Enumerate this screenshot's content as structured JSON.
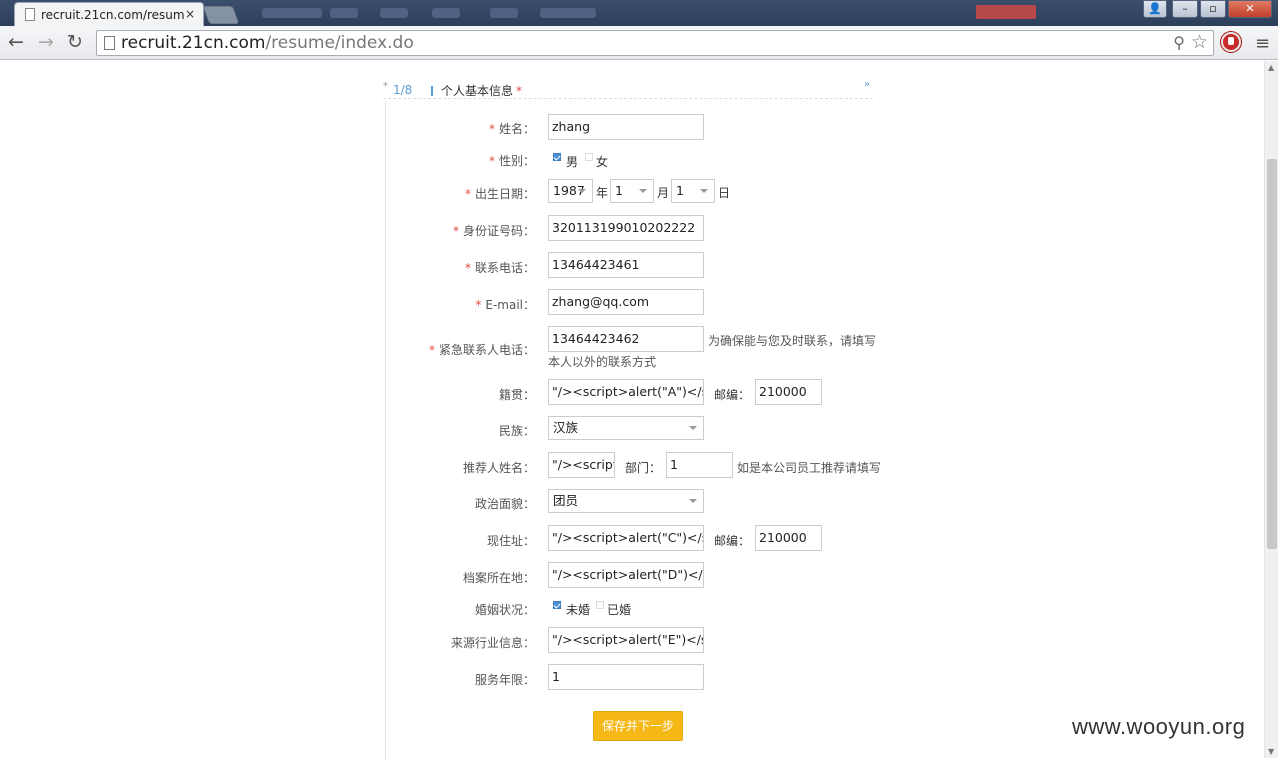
{
  "browser": {
    "tab_title": "recruit.21cn.com/resum",
    "tab_close": "×",
    "url_host": "recruit.21cn.com",
    "url_path": "/resume/index.do",
    "menu": "≡"
  },
  "section": {
    "step": "1/8",
    "title": "个人基本信息",
    "required_mark": "*"
  },
  "form": {
    "name": {
      "label": "姓名：",
      "value": "zhang"
    },
    "gender": {
      "label": "性别：",
      "options": [
        "男",
        "女"
      ],
      "selected": "男"
    },
    "birth": {
      "label": "出生日期：",
      "year": "1987",
      "year_unit": "年",
      "month": "1",
      "month_unit": "月",
      "day": "1",
      "day_unit": "日"
    },
    "id_no": {
      "label": "身份证号码：",
      "value": "320113199010202222"
    },
    "phone": {
      "label": "联系电话：",
      "value": "13464423461"
    },
    "email": {
      "label": "E-mail：",
      "value": "zhang@qq.com"
    },
    "emergency": {
      "label": "紧急联系人电话：",
      "value": "13464423462",
      "hint_line1": "为确保能与您及时联系，请填写",
      "hint_line2": "本人以外的联系方式"
    },
    "native": {
      "label": "籍贯：",
      "value": "\"/><script>alert(\"A\")</scri",
      "zip_label": "邮编：",
      "zip": "210000"
    },
    "ethnic": {
      "label": "民族：",
      "value": "汉族"
    },
    "referrer": {
      "label": "推荐人姓名：",
      "value": "\"/><script",
      "dept_label": "部门：",
      "dept": "1",
      "hint": "如是本公司员工推荐请填写"
    },
    "political": {
      "label": "政治面貌：",
      "value": "团员"
    },
    "address": {
      "label": "现住址：",
      "value": "\"/><script>alert(\"C\")</scri",
      "zip_label": "邮编：",
      "zip": "210000"
    },
    "archive": {
      "label": "档案所在地：",
      "value": "\"/><script>alert(\"D\")</sc"
    },
    "marital": {
      "label": "婚姻状况：",
      "options": [
        "未婚",
        "已婚"
      ],
      "selected": "未婚"
    },
    "industry": {
      "label": "来源行业信息：",
      "value": "\"/><script>alert(\"E\")</scr"
    },
    "service_years": {
      "label": "服务年限：",
      "value": "1"
    }
  },
  "save_button": "保存并下一步",
  "watermark": "www.wooyun.org",
  "colors": {
    "accent_blue": "#5b9bd5",
    "required_red": "#e04b3c",
    "button_yellow": "#f5b817"
  }
}
